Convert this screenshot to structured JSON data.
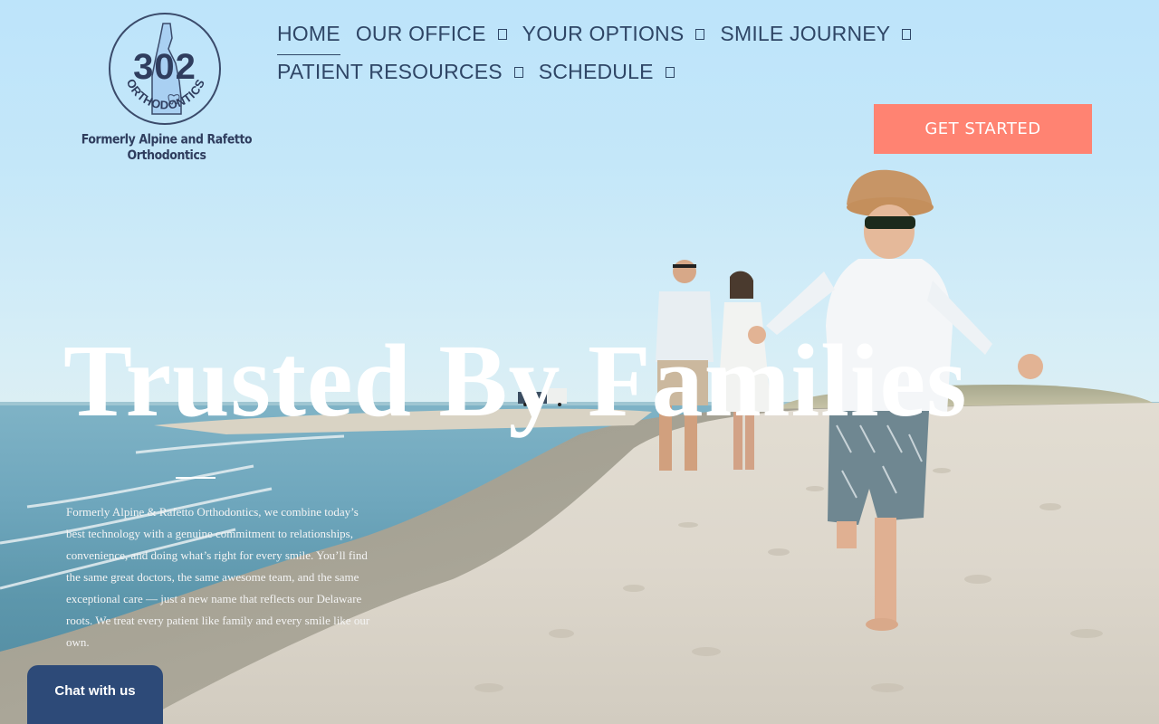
{
  "header": {
    "logo": {
      "number": "302",
      "wordmark": "ORTHODONTICS",
      "tagline": "Formerly Alpine and Rafetto Orthodontics"
    },
    "nav": {
      "row1": [
        {
          "label": "HOME",
          "has_dropdown": false,
          "active": true
        },
        {
          "label": "OUR OFFICE",
          "has_dropdown": true
        },
        {
          "label": "YOUR OPTIONS",
          "has_dropdown": true
        },
        {
          "label": "SMILE JOURNEY",
          "has_dropdown": true
        }
      ],
      "row2": [
        {
          "label": "PATIENT RESOURCES",
          "has_dropdown": true
        },
        {
          "label": "SCHEDULE",
          "has_dropdown": true
        }
      ]
    },
    "cta_label": "GET STARTED"
  },
  "hero": {
    "title": "Trusted By Families",
    "body": "Formerly Alpine & Rafetto Orthodontics, we combine today’s best technology with a genuine commitment to relationships, convenience, and doing what’s right for every smile. You’ll find the same great doctors, the same awesome team, and the same exceptional care — just a new name that reflects our Delaware roots. We treat every patient like family and every smile like our own."
  },
  "chat": {
    "label": "Chat with us"
  },
  "colors": {
    "nav_text": "#2f4666",
    "cta_background": "#ff8372",
    "chat_background": "#2d4a78",
    "logo_navy": "#2f3d5e",
    "hero_text": "#ffffff"
  },
  "icons": {
    "dropdown": "dropdown-caret-icon",
    "logo_map": "delaware-state-icon",
    "logo_tooth": "tooth-icon"
  }
}
